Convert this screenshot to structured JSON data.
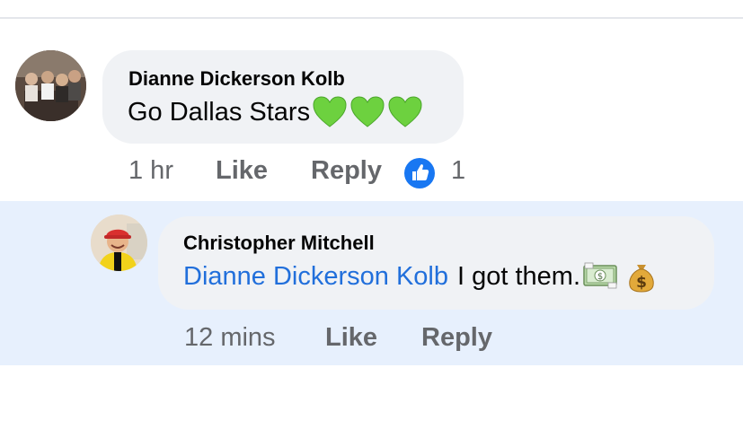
{
  "comments": [
    {
      "author": "Dianne Dickerson Kolb",
      "text": "Go Dallas Stars",
      "emoji": [
        "green-heart",
        "green-heart",
        "green-heart"
      ],
      "time": "1 hr",
      "like_label": "Like",
      "reply_label": "Reply",
      "reaction_count": "1",
      "reaction_icon": "like-thumb-icon"
    },
    {
      "author": "Christopher Mitchell",
      "mention": "Dianne Dickerson Kolb",
      "text": "I got them.",
      "emoji": [
        "money-with-wings",
        "money-bag"
      ],
      "time": "12 mins",
      "like_label": "Like",
      "reply_label": "Reply"
    }
  ],
  "colors": {
    "bubble": "#f0f2f5",
    "highlight": "#e7f0fd",
    "mention": "#216fdb",
    "secondary_text": "#65676b",
    "like_blue": "#1877f2",
    "heart_green": "#6dd13f"
  }
}
